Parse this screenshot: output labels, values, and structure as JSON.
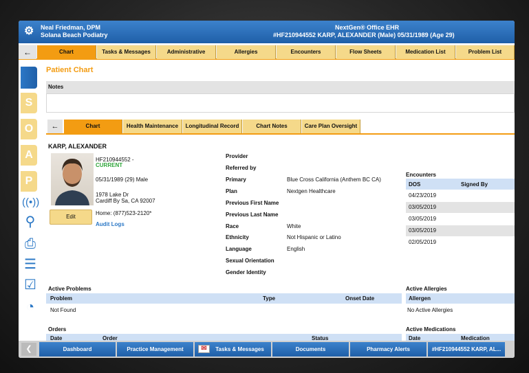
{
  "titlebar": {
    "user": "Neal Friedman, DPM",
    "practice": "Solana Beach Podiatry",
    "app": "NextGen® Office EHR",
    "patient_banner": "#HF210944552   KARP, ALEXANDER   (Male)   05/31/1989   (Age 29)"
  },
  "tabs": [
    "Chart",
    "Tasks & Messages",
    "Administrative",
    "Allergies",
    "Encounters",
    "Flow Sheets",
    "Medication List",
    "Problem List"
  ],
  "page_title": "Patient Chart",
  "notes_label": "Notes",
  "subtabs": [
    "Chart",
    "Health Maintenance",
    "Longitudinal Record",
    "Chart Notes",
    "Care Plan Oversight"
  ],
  "patient": {
    "name": "KARP, ALEXANDER",
    "id": "HF210944552 -",
    "status": "CURRENT",
    "dob": "05/31/1989 (29) Male",
    "addr1": "1978 Lake Dr",
    "addr2": "Cardiff By Sa, CA 92007",
    "phone": "Home: (877)523-2120*",
    "edit": "Edit",
    "audit": "Audit Logs"
  },
  "details": [
    {
      "label": "Provider",
      "value": ""
    },
    {
      "label": "Referred by",
      "value": ""
    },
    {
      "label": "Primary",
      "value": "Blue Cross California (Anthem BC CA)"
    },
    {
      "label": "Plan",
      "value": "Nextgen Healthcare"
    },
    {
      "label": "Previous First Name",
      "value": ""
    },
    {
      "label": "Previous Last Name",
      "value": ""
    },
    {
      "label": "Race",
      "value": "White"
    },
    {
      "label": "Ethnicity",
      "value": "Not Hispanic or Latino"
    },
    {
      "label": "Language",
      "value": "English"
    },
    {
      "label": "Sexual Orientation",
      "value": ""
    },
    {
      "label": "Gender Identity",
      "value": ""
    }
  ],
  "encounters": {
    "title": "Encounters",
    "headers": [
      "DOS",
      "Signed By"
    ],
    "rows": [
      "04/23/2019",
      "03/05/2019",
      "03/05/2019",
      "03/05/2019",
      "02/05/2019"
    ]
  },
  "problems": {
    "title": "Active Problems",
    "headers": [
      "Problem",
      "Type",
      "Onset Date"
    ],
    "empty": "Not Found"
  },
  "allergies": {
    "title": "Active Allergies",
    "header": "Allergen",
    "empty": "No Active Allergies"
  },
  "orders": {
    "title": "Orders",
    "headers": [
      "Date",
      "Order",
      "Status"
    ]
  },
  "medications": {
    "title": "Active Medications",
    "headers": [
      "Date",
      "Medication"
    ]
  },
  "bottom": [
    "Dashboard",
    "Practice Management",
    "Tasks & Messages",
    "Documents",
    "Pharmacy Alerts",
    "#HF210944552  KARP, AL..."
  ],
  "soap": [
    "S",
    "O",
    "A",
    "P"
  ]
}
